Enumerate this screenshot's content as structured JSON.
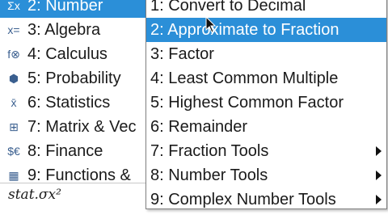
{
  "left_menu": {
    "items": [
      {
        "icon": "Σx",
        "icon_name": "number-icon",
        "label": "2: Number"
      },
      {
        "icon": "x=",
        "icon_name": "algebra-icon",
        "label": "3: Algebra"
      },
      {
        "icon": "f⊗",
        "icon_name": "calculus-icon",
        "label": "4: Calculus"
      },
      {
        "icon": "⬢",
        "icon_name": "dice-icon",
        "label": "5: Probability"
      },
      {
        "icon": "x̄",
        "icon_name": "statistics-icon",
        "label": "6: Statistics"
      },
      {
        "icon": "⊞",
        "icon_name": "matrix-icon",
        "label": "7: Matrix & Vec"
      },
      {
        "icon": "$€",
        "icon_name": "finance-icon",
        "label": "8: Finance"
      },
      {
        "icon": "▦",
        "icon_name": "functions-icon",
        "label": "9: Functions &"
      }
    ]
  },
  "sub_menu": {
    "items": [
      {
        "label": "1: Convert to Decimal",
        "has_submenu": false
      },
      {
        "label": "2: Approximate to Fraction",
        "has_submenu": false
      },
      {
        "label": "3: Factor",
        "has_submenu": false
      },
      {
        "label": "4: Least Common Multiple",
        "has_submenu": false
      },
      {
        "label": "5: Highest Common Factor",
        "has_submenu": false
      },
      {
        "label": "6: Remainder",
        "has_submenu": false
      },
      {
        "label": "7: Fraction Tools",
        "has_submenu": true
      },
      {
        "label": "8: Number Tools",
        "has_submenu": true
      },
      {
        "label": "9: Complex Number Tools",
        "has_submenu": true
      }
    ]
  },
  "status": {
    "text": "stat.σx²"
  },
  "colors": {
    "highlight": "#2b8fd8",
    "text": "#1a1a1a"
  }
}
